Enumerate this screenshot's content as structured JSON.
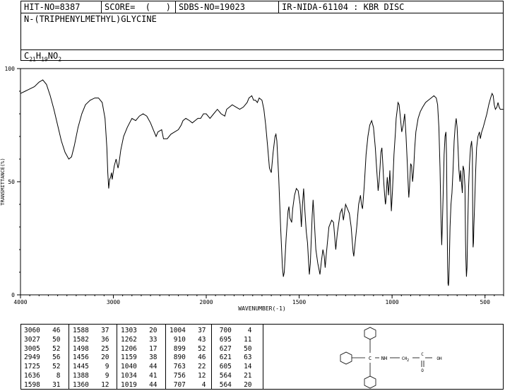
{
  "header": {
    "hit_no": "HIT-NO=8387",
    "score": "SCORE=  (   )",
    "sdbs_no": "SDBS-NO=19023",
    "ir_info": "IR-NIDA-61104 : KBR DISC",
    "compound_name": "N-(TRIPHENYLMETHYL)GLYCINE",
    "formula": {
      "c": "C",
      "c_n": "21",
      "h": "H",
      "h_n": "19",
      "n": "N",
      "o": "O",
      "o_n": "2"
    }
  },
  "chart_data": {
    "type": "line",
    "xlabel": "WAVENUMBER(-1)",
    "ylabel": "TRANSMITTANCE(%)",
    "xlim": [
      4000,
      400
    ],
    "ylim": [
      0,
      100
    ],
    "x_ticks": [
      "4000",
      "3000",
      "2000",
      "1500",
      "1000",
      "500"
    ],
    "y_ticks": [
      "100",
      "50",
      "0"
    ],
    "series": [
      {
        "color": "#000000",
        "points": [
          [
            4000,
            89
          ],
          [
            3950,
            90
          ],
          [
            3900,
            91
          ],
          [
            3850,
            92
          ],
          [
            3800,
            94
          ],
          [
            3760,
            95
          ],
          [
            3720,
            93
          ],
          [
            3680,
            88
          ],
          [
            3640,
            82
          ],
          [
            3600,
            75
          ],
          [
            3560,
            68
          ],
          [
            3520,
            63
          ],
          [
            3480,
            60
          ],
          [
            3450,
            61
          ],
          [
            3420,
            66
          ],
          [
            3380,
            74
          ],
          [
            3340,
            80
          ],
          [
            3300,
            84
          ],
          [
            3250,
            86
          ],
          [
            3200,
            87
          ],
          [
            3160,
            87
          ],
          [
            3120,
            85
          ],
          [
            3090,
            78
          ],
          [
            3070,
            65
          ],
          [
            3060,
            54
          ],
          [
            3050,
            47
          ],
          [
            3040,
            51
          ],
          [
            3030,
            52
          ],
          [
            3020,
            54
          ],
          [
            3012,
            51
          ],
          [
            3005,
            53
          ],
          [
            2990,
            57
          ],
          [
            2970,
            60
          ],
          [
            2950,
            56
          ],
          [
            2940,
            58
          ],
          [
            2920,
            64
          ],
          [
            2890,
            70
          ],
          [
            2850,
            74
          ],
          [
            2800,
            78
          ],
          [
            2760,
            77
          ],
          [
            2720,
            79
          ],
          [
            2680,
            80
          ],
          [
            2640,
            79
          ],
          [
            2600,
            76
          ],
          [
            2570,
            73
          ],
          [
            2540,
            70
          ],
          [
            2520,
            72
          ],
          [
            2480,
            73
          ],
          [
            2460,
            69
          ],
          [
            2420,
            69
          ],
          [
            2380,
            71
          ],
          [
            2340,
            72
          ],
          [
            2300,
            73
          ],
          [
            2270,
            75
          ],
          [
            2250,
            77
          ],
          [
            2220,
            78
          ],
          [
            2180,
            77
          ],
          [
            2150,
            76
          ],
          [
            2120,
            77
          ],
          [
            2090,
            78
          ],
          [
            2060,
            78
          ],
          [
            2030,
            80
          ],
          [
            2000,
            80
          ],
          [
            1980,
            78
          ],
          [
            1960,
            80
          ],
          [
            1940,
            82
          ],
          [
            1920,
            80
          ],
          [
            1900,
            79
          ],
          [
            1890,
            82
          ],
          [
            1860,
            84
          ],
          [
            1840,
            83
          ],
          [
            1820,
            82
          ],
          [
            1800,
            83
          ],
          [
            1780,
            85
          ],
          [
            1770,
            87
          ],
          [
            1755,
            88
          ],
          [
            1745,
            86
          ],
          [
            1735,
            86
          ],
          [
            1725,
            85
          ],
          [
            1715,
            87
          ],
          [
            1700,
            86
          ],
          [
            1690,
            82
          ],
          [
            1680,
            75
          ],
          [
            1670,
            66
          ],
          [
            1660,
            56
          ],
          [
            1650,
            54
          ],
          [
            1640,
            63
          ],
          [
            1630,
            70
          ],
          [
            1625,
            71
          ],
          [
            1620,
            68
          ],
          [
            1610,
            52
          ],
          [
            1600,
            30
          ],
          [
            1590,
            12
          ],
          [
            1585,
            8
          ],
          [
            1580,
            10
          ],
          [
            1570,
            25
          ],
          [
            1560,
            37
          ],
          [
            1555,
            39
          ],
          [
            1550,
            34
          ],
          [
            1540,
            32
          ],
          [
            1535,
            38
          ],
          [
            1525,
            44
          ],
          [
            1515,
            47
          ],
          [
            1505,
            46
          ],
          [
            1495,
            40
          ],
          [
            1488,
            30
          ],
          [
            1482,
            40
          ],
          [
            1476,
            47
          ],
          [
            1470,
            38
          ],
          [
            1462,
            28
          ],
          [
            1455,
            23
          ],
          [
            1448,
            13
          ],
          [
            1445,
            9
          ],
          [
            1440,
            14
          ],
          [
            1430,
            35
          ],
          [
            1425,
            42
          ],
          [
            1420,
            35
          ],
          [
            1410,
            20
          ],
          [
            1400,
            14
          ],
          [
            1395,
            12
          ],
          [
            1388,
            9
          ],
          [
            1380,
            15
          ],
          [
            1372,
            20
          ],
          [
            1365,
            17
          ],
          [
            1360,
            12
          ],
          [
            1355,
            17
          ],
          [
            1340,
            30
          ],
          [
            1325,
            33
          ],
          [
            1315,
            32
          ],
          [
            1303,
            20
          ],
          [
            1295,
            27
          ],
          [
            1280,
            36
          ],
          [
            1270,
            38
          ],
          [
            1262,
            33
          ],
          [
            1250,
            40
          ],
          [
            1240,
            38
          ],
          [
            1230,
            36
          ],
          [
            1220,
            30
          ],
          [
            1210,
            19
          ],
          [
            1206,
            17
          ],
          [
            1200,
            22
          ],
          [
            1190,
            30
          ],
          [
            1180,
            40
          ],
          [
            1170,
            44
          ],
          [
            1165,
            40
          ],
          [
            1159,
            38
          ],
          [
            1150,
            48
          ],
          [
            1140,
            62
          ],
          [
            1130,
            70
          ],
          [
            1120,
            75
          ],
          [
            1110,
            77
          ],
          [
            1100,
            74
          ],
          [
            1090,
            65
          ],
          [
            1085,
            58
          ],
          [
            1080,
            52
          ],
          [
            1075,
            46
          ],
          [
            1070,
            50
          ],
          [
            1065,
            56
          ],
          [
            1060,
            63
          ],
          [
            1055,
            65
          ],
          [
            1050,
            58
          ],
          [
            1045,
            50
          ],
          [
            1040,
            44
          ],
          [
            1036,
            40
          ],
          [
            1034,
            41
          ],
          [
            1030,
            46
          ],
          [
            1026,
            52
          ],
          [
            1022,
            48
          ],
          [
            1019,
            44
          ],
          [
            1012,
            55
          ],
          [
            1004,
            37
          ],
          [
            998,
            46
          ],
          [
            990,
            62
          ],
          [
            982,
            72
          ],
          [
            978,
            78
          ],
          [
            972,
            82
          ],
          [
            968,
            85
          ],
          [
            962,
            84
          ],
          [
            955,
            78
          ],
          [
            948,
            72
          ],
          [
            940,
            75
          ],
          [
            932,
            80
          ],
          [
            925,
            70
          ],
          [
            918,
            58
          ],
          [
            912,
            46
          ],
          [
            910,
            43
          ],
          [
            906,
            48
          ],
          [
            900,
            58
          ],
          [
            895,
            57
          ],
          [
            890,
            50
          ],
          [
            885,
            54
          ],
          [
            878,
            65
          ],
          [
            872,
            72
          ],
          [
            860,
            78
          ],
          [
            848,
            81
          ],
          [
            835,
            83
          ],
          [
            820,
            85
          ],
          [
            805,
            86
          ],
          [
            790,
            87
          ],
          [
            775,
            88
          ],
          [
            762,
            87
          ],
          [
            755,
            84
          ],
          [
            748,
            74
          ],
          [
            742,
            56
          ],
          [
            737,
            35
          ],
          [
            733,
            22
          ],
          [
            730,
            30
          ],
          [
            725,
            45
          ],
          [
            720,
            62
          ],
          [
            715,
            70
          ],
          [
            710,
            72
          ],
          [
            707,
            62
          ],
          [
            704,
            35
          ],
          [
            701,
            12
          ],
          [
            699,
            5
          ],
          [
            697,
            4
          ],
          [
            695,
            6
          ],
          [
            692,
            15
          ],
          [
            688,
            30
          ],
          [
            683,
            40
          ],
          [
            678,
            45
          ],
          [
            672,
            55
          ],
          [
            666,
            68
          ],
          [
            660,
            75
          ],
          [
            655,
            78
          ],
          [
            650,
            74
          ],
          [
            645,
            65
          ],
          [
            640,
            55
          ],
          [
            635,
            50
          ],
          [
            631,
            55
          ],
          [
            627,
            50
          ],
          [
            622,
            45
          ],
          [
            618,
            57
          ],
          [
            613,
            55
          ],
          [
            608,
            48
          ],
          [
            605,
            24
          ],
          [
            603,
            16
          ],
          [
            600,
            8
          ],
          [
            597,
            12
          ],
          [
            593,
            30
          ],
          [
            588,
            48
          ],
          [
            583,
            58
          ],
          [
            578,
            65
          ],
          [
            572,
            68
          ],
          [
            568,
            63
          ],
          [
            566,
            35
          ],
          [
            564,
            21
          ],
          [
            562,
            23
          ],
          [
            560,
            30
          ],
          [
            556,
            40
          ],
          [
            550,
            55
          ],
          [
            545,
            65
          ],
          [
            538,
            70
          ],
          [
            530,
            72
          ],
          [
            525,
            69
          ],
          [
            518,
            72
          ],
          [
            510,
            74
          ],
          [
            500,
            77
          ],
          [
            490,
            80
          ],
          [
            480,
            84
          ],
          [
            470,
            87
          ],
          [
            462,
            89
          ],
          [
            456,
            88
          ],
          [
            450,
            84
          ],
          [
            444,
            82
          ],
          [
            436,
            83
          ],
          [
            430,
            85
          ],
          [
            424,
            83
          ],
          [
            418,
            82
          ],
          [
            412,
            82
          ],
          [
            405,
            82
          ],
          [
            400,
            82
          ]
        ]
      }
    ]
  },
  "peak_table": [
    [
      [
        "3060",
        "46"
      ],
      [
        "3027",
        "50"
      ],
      [
        "3005",
        "52"
      ],
      [
        "2949",
        "56"
      ],
      [
        "1725",
        "52"
      ],
      [
        "1636",
        "8"
      ],
      [
        "1598",
        "31"
      ]
    ],
    [
      [
        "1588",
        "37"
      ],
      [
        "1582",
        "36"
      ],
      [
        "1498",
        "25"
      ],
      [
        "1456",
        "20"
      ],
      [
        "1445",
        "9"
      ],
      [
        "1388",
        "9"
      ],
      [
        "1360",
        "12"
      ]
    ],
    [
      [
        "1303",
        "20"
      ],
      [
        "1262",
        "33"
      ],
      [
        "1206",
        "17"
      ],
      [
        "1159",
        "38"
      ],
      [
        "1040",
        "44"
      ],
      [
        "1034",
        "41"
      ],
      [
        "1019",
        "44"
      ]
    ],
    [
      [
        "1004",
        "37"
      ],
      [
        "910",
        "43"
      ],
      [
        "899",
        "52"
      ],
      [
        "890",
        "46"
      ],
      [
        "763",
        "22"
      ],
      [
        "756",
        "12"
      ],
      [
        "707",
        "4"
      ]
    ],
    [
      [
        "700",
        "4"
      ],
      [
        "695",
        "11"
      ],
      [
        "627",
        "50"
      ],
      [
        "621",
        "63"
      ],
      [
        "605",
        "14"
      ],
      [
        "564",
        "21"
      ],
      [
        "564",
        "20"
      ]
    ]
  ],
  "structure": {
    "nh": "NH",
    "ch2": "CH",
    "ch2_sub": "2",
    "c": "C",
    "o": "O",
    "oh": "OH"
  }
}
